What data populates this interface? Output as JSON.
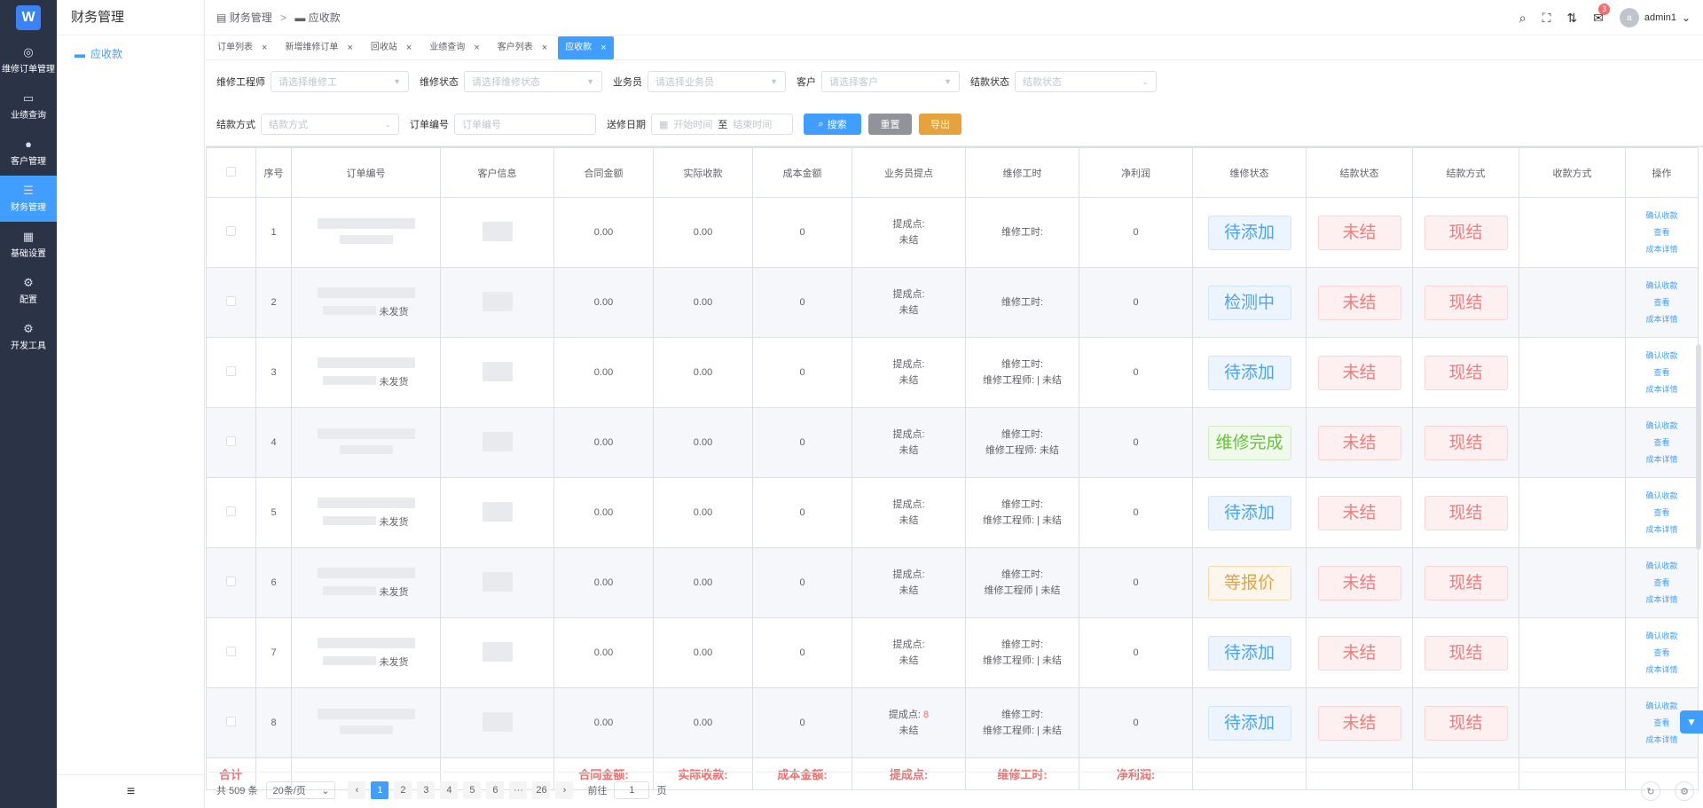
{
  "app": {
    "logo": "W"
  },
  "rail": [
    {
      "label": "维修订单管理",
      "icon": "chip-icon",
      "glyph": "◎"
    },
    {
      "label": "业绩查询",
      "icon": "monitor-icon",
      "glyph": "▭"
    },
    {
      "label": "客户管理",
      "icon": "user-icon",
      "glyph": "●"
    },
    {
      "label": "财务管理",
      "icon": "database-icon",
      "glyph": "☰"
    },
    {
      "label": "基础设置",
      "icon": "grid-icon",
      "glyph": "▦"
    },
    {
      "label": "配置",
      "icon": "gear-icon",
      "glyph": "⚙"
    },
    {
      "label": "开发工具",
      "icon": "gear-icon",
      "glyph": "⚙"
    }
  ],
  "submenu": {
    "title": "财务管理",
    "item": "应收款"
  },
  "breadcrumb": {
    "parent": "财务管理",
    "current": "应收款"
  },
  "topbar": {
    "badge": "3",
    "avatar": "a",
    "user": "admin1"
  },
  "tabs": [
    "订单列表",
    "新增维修订单",
    "回收站",
    "业绩查询",
    "客户列表",
    "应收款"
  ],
  "filters": {
    "engineer_label": "维修工程师",
    "engineer_ph": "请选择维修工",
    "repair_status_label": "维修状态",
    "repair_status_ph": "请选择维修状态",
    "sales_label": "业务员",
    "sales_ph": "请选择业务员",
    "customer_label": "客户",
    "customer_ph": "请选择客户",
    "settle_status_label": "结款状态",
    "settle_status_ph": "结款状态",
    "settle_method_label": "结款方式",
    "settle_method_ph": "结款方式",
    "order_no_label": "订单编号",
    "order_no_ph": "订单编号",
    "date_label": "送修日期",
    "date_start": "开始时间",
    "date_to": "至",
    "date_end": "结束时间",
    "search": "搜索",
    "reset": "重置",
    "export": "导出"
  },
  "table": {
    "headers": [
      "序号",
      "订单编号",
      "客户信息",
      "合同金额",
      "实际收款",
      "成本金额",
      "业务员提点",
      "维修工时",
      "净利润",
      "维修状态",
      "结款状态",
      "结款方式",
      "收款方式",
      "操作"
    ],
    "rows": [
      {
        "no": "1",
        "order_extra": "",
        "contract": "0.00",
        "received": "0.00",
        "cost": "0",
        "commission": "提成点:",
        "comm_value": "",
        "comm_status": "未结",
        "hours": "维修工时:",
        "hours_detail": "",
        "profit": "0",
        "repair_status": "待添加",
        "repair_color": "blue",
        "settle_status": "未结",
        "settle_method": "现结",
        "pay_method": ""
      },
      {
        "no": "2",
        "order_extra": "未发货",
        "contract": "0.00",
        "received": "0.00",
        "cost": "0",
        "commission": "提成点:",
        "comm_value": "",
        "comm_status": "未结",
        "hours": "维修工时:",
        "hours_detail": "",
        "profit": "0",
        "repair_status": "检测中",
        "repair_color": "blue",
        "settle_status": "未结",
        "settle_method": "现结",
        "pay_method": ""
      },
      {
        "no": "3",
        "order_extra": "未发货",
        "contract": "0.00",
        "received": "0.00",
        "cost": "0",
        "commission": "提成点:",
        "comm_value": "",
        "comm_status": "未结",
        "hours": "维修工时:",
        "hours_detail": "维修工程师: | 未结",
        "profit": "0",
        "repair_status": "待添加",
        "repair_color": "blue",
        "settle_status": "未结",
        "settle_method": "现结",
        "pay_method": ""
      },
      {
        "no": "4",
        "order_extra": "",
        "contract": "0.00",
        "received": "0.00",
        "cost": "0",
        "commission": "提成点:",
        "comm_value": "",
        "comm_status": "未结",
        "hours": "维修工时:",
        "hours_detail": "维修工程师: 未结",
        "profit": "0",
        "repair_status": "维修完成",
        "repair_color": "green",
        "settle_status": "未结",
        "settle_method": "现结",
        "pay_method": ""
      },
      {
        "no": "5",
        "order_extra": "未发货",
        "contract": "0.00",
        "received": "0.00",
        "cost": "0",
        "commission": "提成点:",
        "comm_value": "",
        "comm_status": "未结",
        "hours": "维修工时:",
        "hours_detail": "维修工程师: | 未结",
        "profit": "0",
        "repair_status": "待添加",
        "repair_color": "blue",
        "settle_status": "未结",
        "settle_method": "现结",
        "pay_method": ""
      },
      {
        "no": "6",
        "order_extra": "未发货",
        "contract": "0.00",
        "received": "0.00",
        "cost": "0",
        "commission": "提成点:",
        "comm_value": "",
        "comm_status": "未结",
        "hours": "维修工时:",
        "hours_detail": "维修工程师 | 未结",
        "profit": "0",
        "repair_status": "等报价",
        "repair_color": "orange",
        "settle_status": "未结",
        "settle_method": "现结",
        "pay_method": ""
      },
      {
        "no": "7",
        "order_extra": "未发货",
        "contract": "0.00",
        "received": "0.00",
        "cost": "0",
        "commission": "提成点:",
        "comm_value": "",
        "comm_status": "未结",
        "hours": "维修工时:",
        "hours_detail": "维修工程师: | 未结",
        "profit": "0",
        "repair_status": "待添加",
        "repair_color": "blue",
        "settle_status": "未结",
        "settle_method": "现结",
        "pay_method": ""
      },
      {
        "no": "8",
        "order_extra": "",
        "contract": "0.00",
        "received": "0.00",
        "cost": "0",
        "commission": "提成点:",
        "comm_value": "8",
        "comm_status": "未结",
        "hours": "维修工时:",
        "hours_detail": "维修工程师: | 未结",
        "profit": "0",
        "repair_status": "待添加",
        "repair_color": "blue",
        "settle_status": "未结",
        "settle_method": "现结",
        "pay_method": ""
      }
    ],
    "ops": [
      "确认收款",
      "查看",
      "成本详情"
    ],
    "sum": {
      "label": "合计",
      "contract": "合同金额:",
      "received": "实际收款:",
      "cost": "成本金额:",
      "commission": "提成点:",
      "hours": "维修工时:",
      "profit": "净利润:"
    }
  },
  "pager": {
    "total": "共 509 条",
    "size": "20条/页",
    "pages": [
      "1",
      "2",
      "3",
      "4",
      "5",
      "6",
      "···",
      "26"
    ],
    "goto": "前往",
    "page_input": "1",
    "page_unit": "页"
  }
}
